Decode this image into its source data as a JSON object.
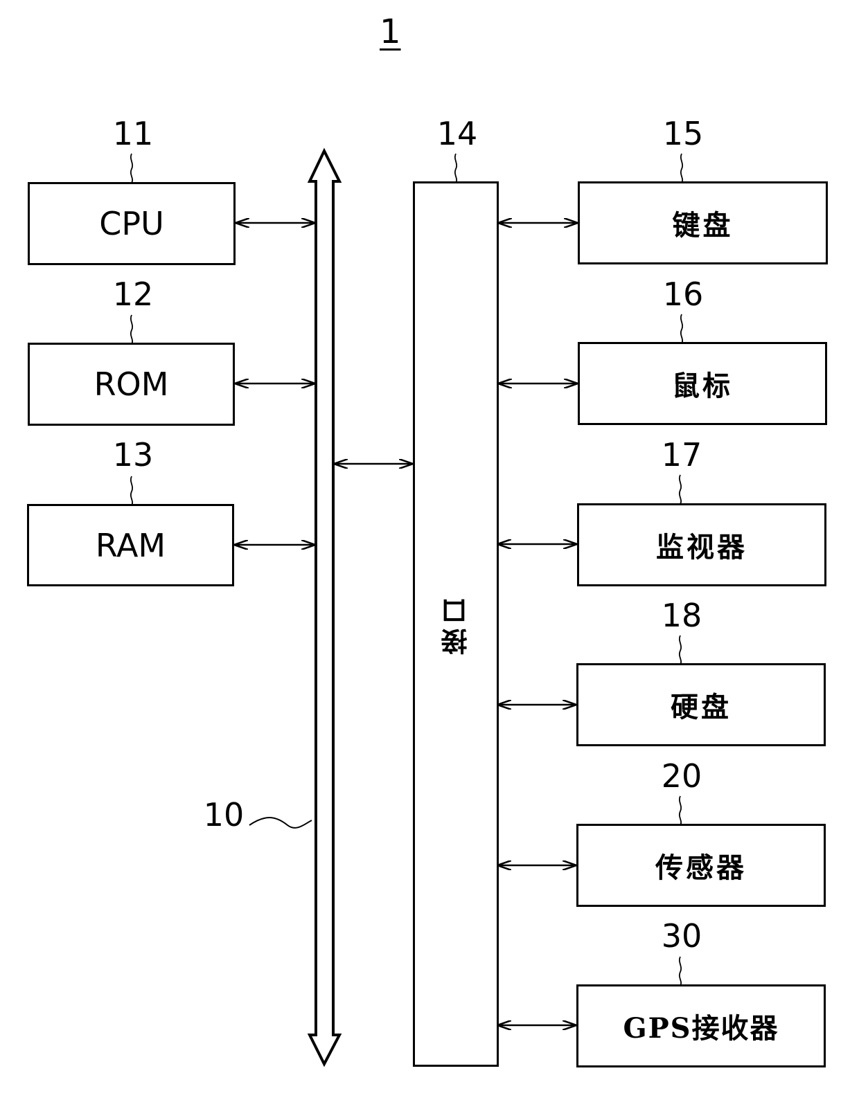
{
  "figure": {
    "number": "1",
    "bus": {
      "ref": "10"
    },
    "interface": {
      "ref": "14",
      "label": "接口"
    },
    "left_blocks": [
      {
        "ref": "11",
        "label": "CPU"
      },
      {
        "ref": "12",
        "label": "ROM"
      },
      {
        "ref": "13",
        "label": "RAM"
      }
    ],
    "right_blocks": [
      {
        "ref": "15",
        "label": "键盘"
      },
      {
        "ref": "16",
        "label": "鼠标"
      },
      {
        "ref": "17",
        "label": "监视器"
      },
      {
        "ref": "18",
        "label": "硬盘"
      },
      {
        "ref": "20",
        "label": "传感器"
      },
      {
        "ref": "30",
        "label": "GPS接收器"
      }
    ]
  }
}
